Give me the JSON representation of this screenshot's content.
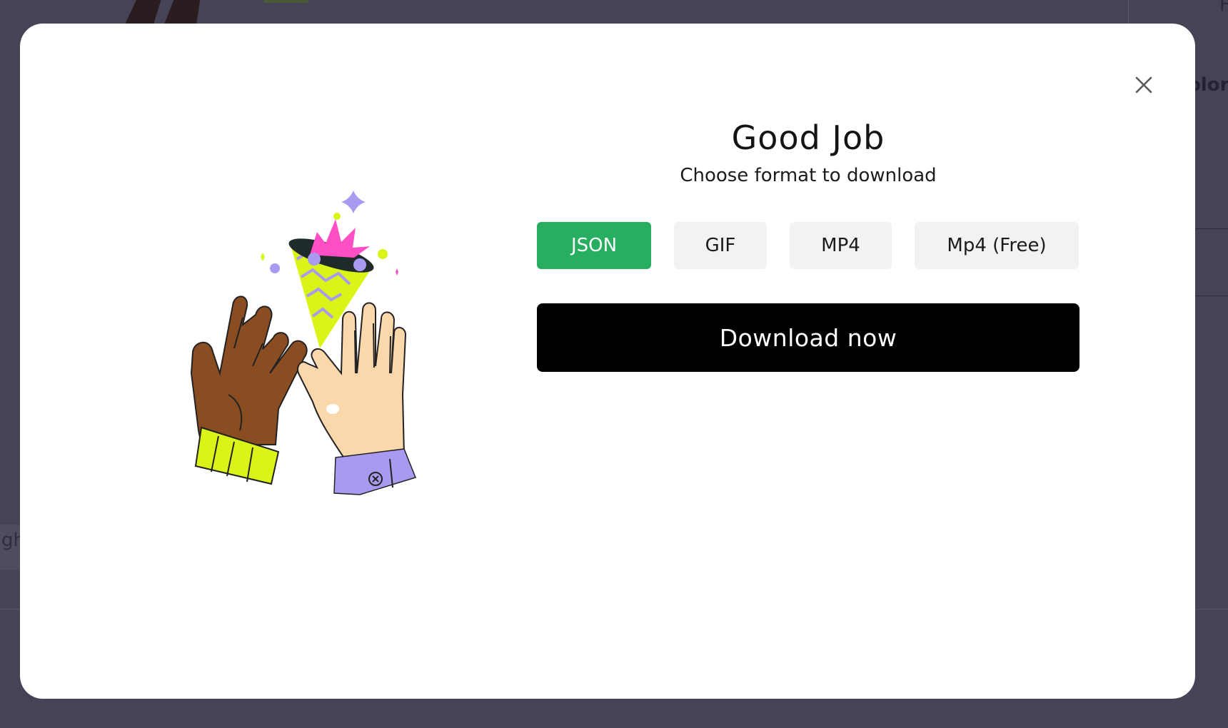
{
  "background": {
    "partial_text_right": "olors",
    "partial_text_top_right": "F",
    "partial_text_left": "gh"
  },
  "modal": {
    "title": "Good Job",
    "subtitle": "Choose format to download",
    "formats": [
      {
        "label": "JSON",
        "selected": true
      },
      {
        "label": "GIF",
        "selected": false
      },
      {
        "label": "MP4",
        "selected": false
      },
      {
        "label": "Mp4 (Free)",
        "selected": false
      }
    ],
    "download_label": "Download now",
    "close_icon": "close-icon",
    "illustration": "high-five-hands-with-party-popper"
  },
  "colors": {
    "overlay": "#454457",
    "selected_format": "#28ae60",
    "format_bg": "#f2f2f2",
    "download_bg": "#000000",
    "skin_dark": "#8a4d22",
    "skin_light": "#fbd7ac",
    "cuff_lime": "#d9f416",
    "cuff_purple": "#a99af0",
    "popper_pink": "#ff4fc7"
  }
}
